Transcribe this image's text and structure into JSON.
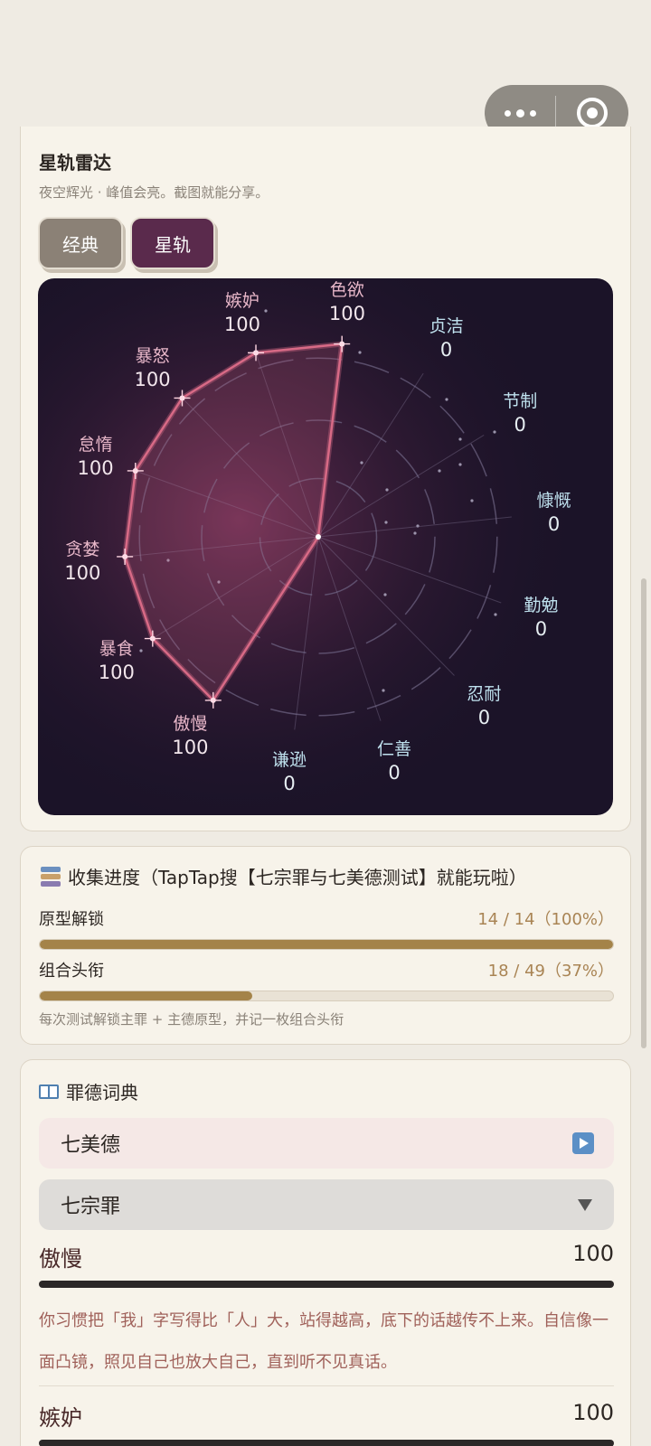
{
  "radar": {
    "title": "星轨雷达",
    "subtitle": "夜空辉光 · 峰值会亮。截图就能分享。",
    "modes": [
      "经典",
      "星轨"
    ],
    "active_mode": "星轨",
    "axes": [
      {
        "name": "色欲",
        "value": "100",
        "kind": "sin"
      },
      {
        "name": "贞洁",
        "value": "0",
        "kind": "virtue"
      },
      {
        "name": "节制",
        "value": "0",
        "kind": "virtue"
      },
      {
        "name": "慷慨",
        "value": "0",
        "kind": "virtue"
      },
      {
        "name": "勤勉",
        "value": "0",
        "kind": "virtue"
      },
      {
        "name": "忍耐",
        "value": "0",
        "kind": "virtue"
      },
      {
        "name": "仁善",
        "value": "0",
        "kind": "virtue"
      },
      {
        "name": "谦逊",
        "value": "0",
        "kind": "virtue"
      },
      {
        "name": "傲慢",
        "value": "100",
        "kind": "sin"
      },
      {
        "name": "暴食",
        "value": "100",
        "kind": "sin"
      },
      {
        "name": "贪婪",
        "value": "100",
        "kind": "sin"
      },
      {
        "name": "怠惰",
        "value": "100",
        "kind": "sin"
      },
      {
        "name": "暴怒",
        "value": "100",
        "kind": "sin"
      },
      {
        "name": "嫉妒",
        "value": "100",
        "kind": "sin"
      }
    ],
    "colors": {
      "line": "#d86a86",
      "bg": "#1b1328",
      "sin_label": "#e8b7c9",
      "virtue_label": "#bfe1ee"
    }
  },
  "progress": {
    "title": "收集进度（TapTap搜【七宗罪与七美德测试】就能玩啦）",
    "rows": [
      {
        "label": "原型解锁",
        "value": "14 / 14（100%）",
        "fraction": 1.0
      },
      {
        "label": "组合头衔",
        "value": "18 / 49（37%）",
        "fraction": 0.37
      }
    ],
    "note": "每次测试解锁主罪 + 主德原型，并记一枚组合头衔"
  },
  "dictionary": {
    "title": "罪德词典",
    "groups": [
      {
        "label": "七美德",
        "icon": "play-icon"
      },
      {
        "label": "七宗罪",
        "icon": "caret-down-icon"
      }
    ],
    "entries": [
      {
        "name": "傲慢",
        "value": "100",
        "desc": "你习惯把「我」字写得比「人」大，站得越高，底下的话越传不上来。自信像一面凸镜，照见自己也放大自己，直到听不见真话。"
      },
      {
        "name": "嫉妒",
        "value": "100",
        "desc": ""
      }
    ]
  }
}
